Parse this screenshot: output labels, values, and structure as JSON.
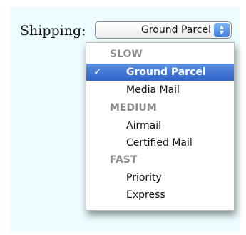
{
  "shipping": {
    "label": "Shipping:",
    "selected_value": "Ground Parcel",
    "stepper_up": "▲",
    "stepper_down": "▼"
  },
  "menu": {
    "check_glyph": "✓",
    "groups": [
      {
        "label": "SLOW",
        "items": [
          "Ground Parcel",
          "Media Mail"
        ]
      },
      {
        "label": "MEDIUM",
        "items": [
          "Airmail",
          "Certified Mail"
        ]
      },
      {
        "label": "FAST",
        "items": [
          "Priority",
          "Express"
        ]
      }
    ]
  },
  "colors": {
    "panel_background": "#edfdff",
    "selection": "#3b6fd0",
    "group_header": "#8d8d8d"
  }
}
